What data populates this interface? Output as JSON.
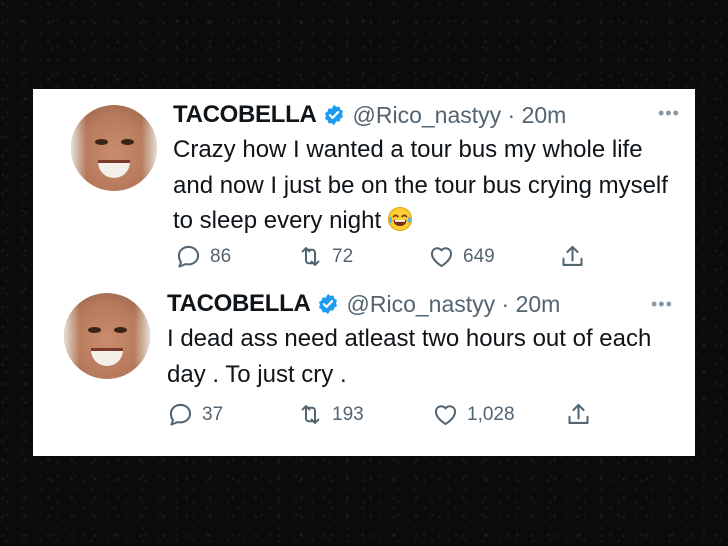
{
  "tweets": [
    {
      "display_name": "TACOBELLA",
      "handle": "@Rico_nastyy",
      "time": "20m",
      "text": "Crazy how I wanted a tour bus my whole life and now I just be on the tour bus crying myself to sleep every night",
      "emoji": "tears-of-joy-emoji",
      "replies": "86",
      "retweets": "72",
      "likes": "649"
    },
    {
      "display_name": "TACOBELLA",
      "handle": "@Rico_nastyy",
      "time": "20m",
      "text": "I dead ass need atleast two hours out of each day . To just cry .",
      "replies": "37",
      "retweets": "193",
      "likes": "1,028"
    }
  ],
  "icons": {
    "verified": "verified-badge-icon",
    "more": "more-options-icon",
    "reply": "reply-icon",
    "retweet": "retweet-icon",
    "like": "like-icon",
    "share": "share-icon"
  },
  "colors": {
    "verified_blue": "#1d9bf0",
    "text": "#0f1419",
    "secondary": "#536471",
    "background": "#0b0b0b"
  }
}
